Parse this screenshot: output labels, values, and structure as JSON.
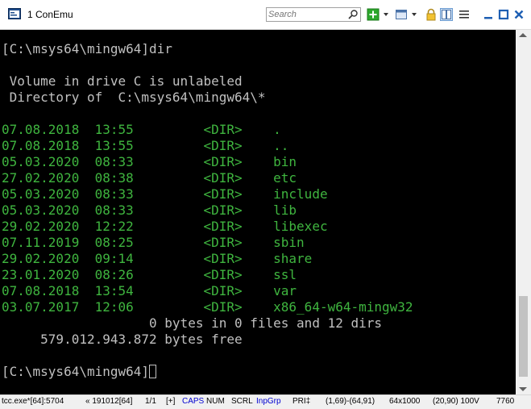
{
  "titlebar": {
    "title": "1 ConEmu",
    "search_placeholder": "Search",
    "icons": [
      "conemu-app-icon",
      "search-icon",
      "new-console-plus-icon",
      "dropdown-arrow-icon",
      "console-list-icon",
      "dropdown-arrow-icon",
      "lock-icon",
      "split-view-icon",
      "settings-menu-icon",
      "minimize-icon",
      "maximize-icon",
      "close-icon"
    ]
  },
  "console": {
    "lines": [
      {
        "text": "[C:\\msys64\\mingw64]dir",
        "cls": ""
      },
      {
        "text": "",
        "cls": ""
      },
      {
        "text": " Volume in drive C is unlabeled",
        "cls": ""
      },
      {
        "text": " Directory of  C:\\msys64\\mingw64\\*",
        "cls": ""
      },
      {
        "text": "",
        "cls": ""
      },
      {
        "text": "07.08.2018  13:55         <DIR>    .",
        "cls": "g"
      },
      {
        "text": "07.08.2018  13:55         <DIR>    ..",
        "cls": "g"
      },
      {
        "text": "05.03.2020  08:33         <DIR>    bin",
        "cls": "g"
      },
      {
        "text": "27.02.2020  08:38         <DIR>    etc",
        "cls": "g"
      },
      {
        "text": "05.03.2020  08:33         <DIR>    include",
        "cls": "g"
      },
      {
        "text": "05.03.2020  08:33         <DIR>    lib",
        "cls": "g"
      },
      {
        "text": "29.02.2020  12:22         <DIR>    libexec",
        "cls": "g"
      },
      {
        "text": "07.11.2019  08:25         <DIR>    sbin",
        "cls": "g"
      },
      {
        "text": "29.02.2020  09:14         <DIR>    share",
        "cls": "g"
      },
      {
        "text": "23.01.2020  08:26         <DIR>    ssl",
        "cls": "g"
      },
      {
        "text": "07.08.2018  13:54         <DIR>    var",
        "cls": "g"
      },
      {
        "text": "03.07.2017  12:06         <DIR>    x86_64-w64-mingw32",
        "cls": "g"
      },
      {
        "text": "                   0 bytes in 0 files and 12 dirs",
        "cls": ""
      },
      {
        "text": "     579.012.943.872 bytes free",
        "cls": ""
      },
      {
        "text": "",
        "cls": ""
      }
    ],
    "prompt": "[C:\\msys64\\mingw64]"
  },
  "statusbar": {
    "process": "tcc.exe*[64]:5704",
    "pid": "« 191012[64]",
    "console_index": "1/1",
    "flag": "[+]",
    "caps": "CAPS",
    "num": "NUM",
    "scrl": "SCRL",
    "input_group": "InpGrp",
    "priority": "PRI‡",
    "selection": "(1,69)-(64,91)",
    "buffer": "64x1000",
    "cursor": "(20,90) 100V",
    "pid_tail": "7760"
  },
  "colors": {
    "text": "#c0c0c0",
    "dir_listing": "#3fb53f",
    "accent_blue": "#0000d0"
  }
}
